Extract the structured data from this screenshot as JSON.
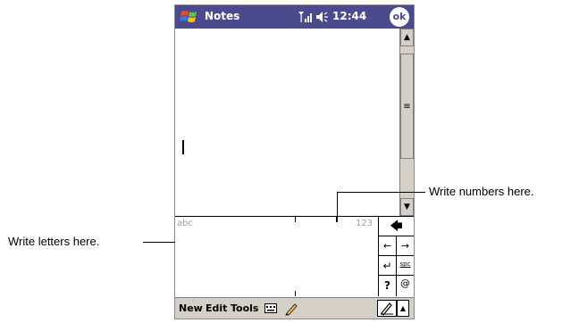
{
  "titlebar": {
    "title": "Notes",
    "clock": "12:44",
    "ok_label": "ok",
    "background": "#4b4a8c",
    "icons": [
      "windows-start-icon",
      "signal-icon",
      "volume-icon"
    ]
  },
  "input_panel": {
    "letters_label": "abc",
    "numbers_label": "123",
    "keys": {
      "backspace": "←",
      "left": "←",
      "right": "→",
      "enter": "↵",
      "space": "spc",
      "help": "?",
      "symbol": "@"
    }
  },
  "menubar": {
    "items": [
      {
        "label": "New"
      },
      {
        "label": "Edit"
      },
      {
        "label": "Tools"
      }
    ],
    "icons": [
      "keyboard-toggle-icon",
      "pen-icon",
      "input-selector-icon",
      "chevron-up-icon"
    ]
  },
  "callouts": {
    "letters": "Write letters here.",
    "numbers": "Write numbers here."
  }
}
